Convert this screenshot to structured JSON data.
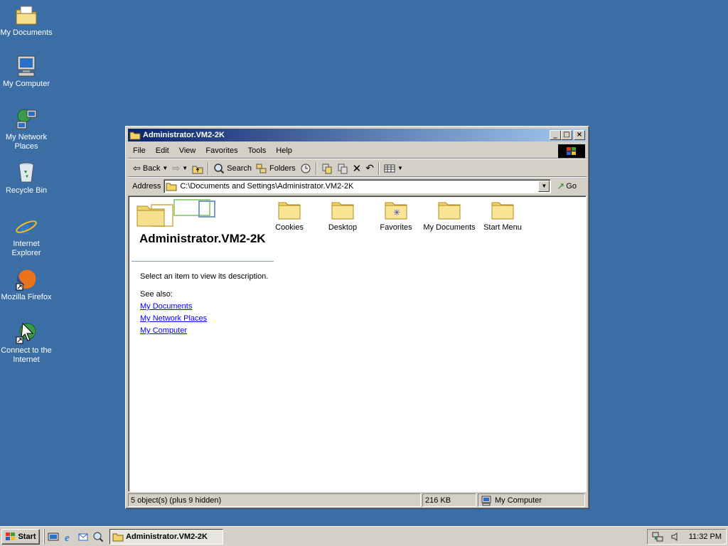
{
  "desktop": {
    "icons": [
      {
        "label": "My Documents",
        "icon": "folder-documents-icon"
      },
      {
        "label": "My Computer",
        "icon": "computer-icon"
      },
      {
        "label": "My Network Places",
        "icon": "network-icon"
      },
      {
        "label": "Recycle Bin",
        "icon": "recycle-bin-icon"
      },
      {
        "label": "Internet Explorer",
        "icon": "ie-icon"
      },
      {
        "label": "Mozilla Firefox",
        "icon": "firefox-icon"
      },
      {
        "label": "Connect to the Internet",
        "icon": "connect-icon"
      }
    ],
    "background": "#3a6ea5"
  },
  "window": {
    "title": "Administrator.VM2-2K",
    "menu": [
      "File",
      "Edit",
      "View",
      "Favorites",
      "Tools",
      "Help"
    ],
    "toolbar": {
      "back_label": "Back",
      "search_label": "Search",
      "folders_label": "Folders"
    },
    "address": {
      "label": "Address",
      "value": "C:\\Documents and Settings\\Administrator.VM2-2K",
      "go_label": "Go"
    },
    "left_pane": {
      "title": "Administrator.VM2-2K",
      "description": "Select an item to view its description.",
      "see_also": "See also:",
      "links": [
        "My Documents",
        "My Network Places",
        "My Computer"
      ]
    },
    "folders": [
      "Cookies",
      "Desktop",
      "Favorites",
      "My Documents",
      "Start Menu"
    ],
    "status": {
      "objects": "5 object(s) (plus 9 hidden)",
      "size": "216 KB",
      "zone": "My Computer"
    }
  },
  "taskbar": {
    "start_label": "Start",
    "task_label": "Administrator.VM2-2K",
    "clock": "11:32 PM"
  }
}
